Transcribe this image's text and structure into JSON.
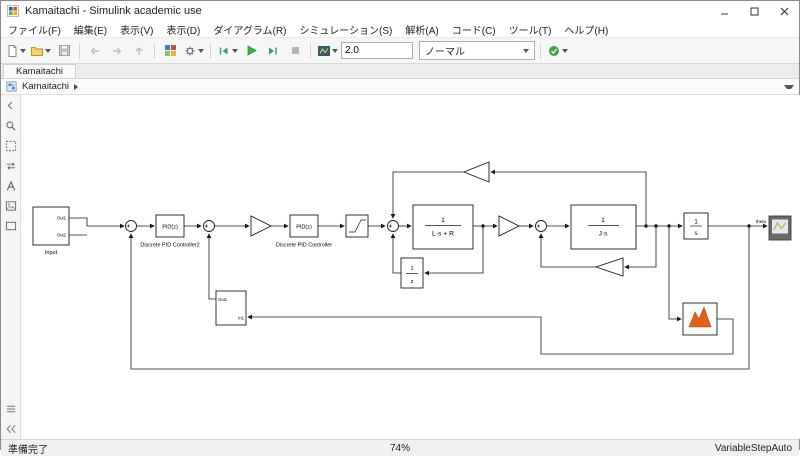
{
  "window": {
    "title": "Kamaitachi - Simulink academic use"
  },
  "menu": {
    "items": [
      "ファイル(F)",
      "編集(E)",
      "表示(V)",
      "表示(D)",
      "ダイアグラム(R)",
      "シミュレーション(S)",
      "解析(A)",
      "コード(C)",
      "ツール(T)",
      "ヘルプ(H)"
    ]
  },
  "toolbar": {
    "sim_time": "2.0",
    "sim_mode": "ノーマル"
  },
  "tab": {
    "label": "Kamaitachi"
  },
  "breadcrumb": {
    "model": "Kamaitachi"
  },
  "statusbar": {
    "status": "準備完了",
    "zoom": "74%",
    "solver": "VariableStepAuto"
  },
  "icons": {
    "toolbar": [
      "new-model-icon",
      "open-icon",
      "save-icon",
      "back-icon",
      "forward-icon",
      "up-icon",
      "library-browser-icon",
      "model-config-icon",
      "step-back-icon",
      "run-icon",
      "step-forward-icon",
      "stop-icon",
      "data-inspector-icon",
      "model-advisor-icon"
    ],
    "palette": [
      "collapse-palette-icon",
      "zoom-icon",
      "fit-to-view-icon",
      "resize-icon",
      "annotation-icon",
      "image-icon",
      "area-icon",
      "legend-icon",
      "collapse-icon"
    ]
  },
  "diagram": {
    "input": {
      "label": "Input",
      "out1": "Out1",
      "out2": "Out2"
    },
    "pid2": {
      "text": "PID(z)",
      "label": "Discrete PID Controller2"
    },
    "pid1": {
      "text": "PID(z)",
      "label": "Discrete PID Controller"
    },
    "tf_electrical": {
      "num": "1",
      "den": "L·s + R"
    },
    "tf_mechanical": {
      "num": "1",
      "den": "J·s"
    },
    "integrator": {
      "num": "1",
      "den": "s"
    },
    "unit_delay": {
      "num": "1",
      "den": "z"
    },
    "subsystem": {
      "in": "In1",
      "out": "Out1"
    },
    "signals": {
      "theta": "theta"
    }
  }
}
